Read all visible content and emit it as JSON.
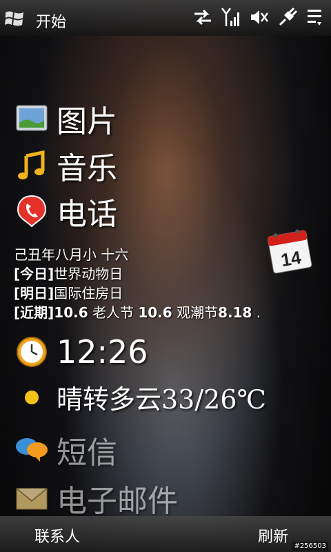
{
  "statusbar": {
    "start_label": "开始",
    "icons": [
      "windows-logo-icon",
      "data-arrows-icon",
      "signal-icon",
      "speaker-mute-icon",
      "power-plug-icon",
      "menu-icon"
    ]
  },
  "tiles": [
    {
      "label": "图片",
      "icon": "pictures-icon"
    },
    {
      "label": "音乐",
      "icon": "music-note-icon"
    },
    {
      "label": "电话",
      "icon": "phone-icon"
    }
  ],
  "lunar": {
    "line1": "己丑年八月小   十六",
    "today_tag": "[今日]",
    "today_text": "世界动物日",
    "tomorrow_tag": "[明日]",
    "tomorrow_text": "国际住房日",
    "upcoming_tag": "[近期]",
    "upcoming_1_date": "10.6",
    "upcoming_1_name": " 老人节 ",
    "upcoming_2_date": "10.6",
    "upcoming_2_name": " 观潮节",
    "upcoming_3_date": "8.18",
    "trailing": " ."
  },
  "calendar_day": "14",
  "clock": {
    "time": "12:26"
  },
  "weather": {
    "text": "晴转多云33/26℃"
  },
  "tiles_bottom": [
    {
      "label": "短信",
      "icon": "chat-bubbles-icon"
    },
    {
      "label": "电子邮件",
      "icon": "envelope-icon"
    }
  ],
  "softkeys": {
    "left": "联系人",
    "right": "刷新"
  },
  "watermark": "#256503"
}
